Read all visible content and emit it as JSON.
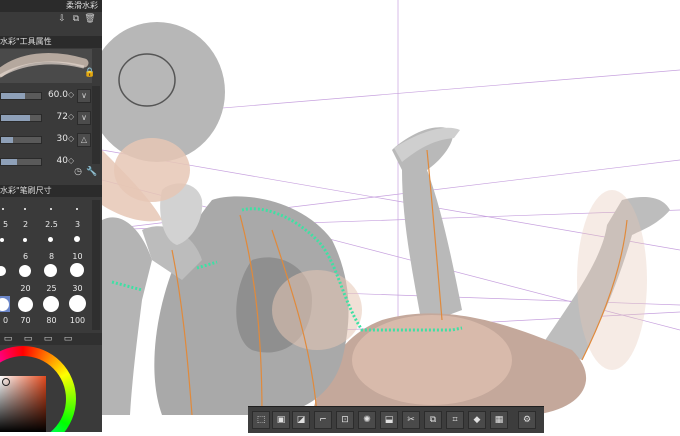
{
  "panel": {
    "title": "柔滑水彩",
    "tool_property_header": "水彩\"工具属性",
    "brush_size_header": "水彩\"笔刷尺寸",
    "values": [
      "60.0",
      "72",
      "30",
      "40"
    ],
    "value_fills": [
      0.6,
      0.72,
      0.3,
      0.4
    ]
  },
  "brush_sizes": {
    "row1": [
      "5",
      "2",
      "2.5",
      "3"
    ],
    "row2": [
      "6",
      "8",
      "10"
    ],
    "row3": [
      "20",
      "25",
      "30"
    ],
    "row4": [
      "0",
      "70",
      "80",
      "100"
    ]
  },
  "toolbar": {
    "icons": [
      "deselect-icon",
      "selection-area-icon",
      "invert-selection-icon",
      "expand-selection-icon",
      "shrink-selection-icon",
      "select-color-icon",
      "selection-launcher-icon",
      "cut-icon",
      "copy-paste-icon",
      "transform-icon",
      "fill-icon",
      "pattern-icon",
      "settings-icon"
    ]
  },
  "colors": {
    "panel_bg": "#3a3a3a",
    "header_bg": "#2b2b2b",
    "figure_gray": "#a8a8a8",
    "skin_tone": "#e6c7b5",
    "selection_green": "#3fe0a4",
    "guide_orange": "#e08a3c",
    "perspective_purple": "#b98ad6"
  }
}
